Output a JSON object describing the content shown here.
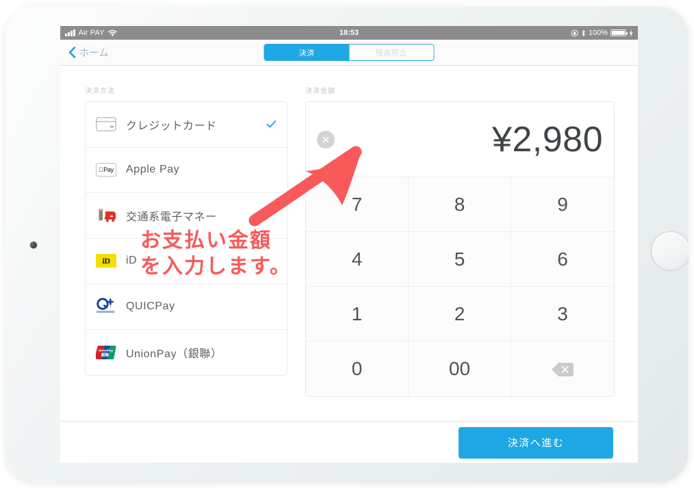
{
  "status_bar": {
    "signal_icon": "signal-bars-icon",
    "carrier": "Air PAY",
    "wifi_icon": "wifi-icon",
    "time": "18:53",
    "rotation_lock_icon": "rotation-lock-icon",
    "bluetooth_icon": "bluetooth-icon",
    "battery_percent": "100%",
    "battery_icon": "battery-icon",
    "charging_icon": "charging-bolt-icon"
  },
  "nav": {
    "back_icon": "chevron-left-icon",
    "back_label": "ホーム",
    "segments": [
      {
        "label": "決済",
        "active": true
      },
      {
        "label": "残高照会",
        "active": false
      }
    ]
  },
  "payment_methods": {
    "section_label": "決済方法",
    "items": [
      {
        "label": "クレジットカード",
        "icon": "credit-card-icon",
        "selected": true
      },
      {
        "label": "Apple Pay",
        "icon": "apple-pay-icon",
        "selected": false
      },
      {
        "label": "交通系電子マネー",
        "icon": "transit-ic-icon",
        "selected": false
      },
      {
        "label": "iD",
        "icon": "id-icon",
        "selected": false
      },
      {
        "label": "QUICPay",
        "icon": "quicpay-icon",
        "selected": false
      },
      {
        "label": "UnionPay（銀聯）",
        "icon": "unionpay-icon",
        "selected": false
      }
    ],
    "check_icon": "checkmark-icon"
  },
  "amount": {
    "section_label": "決済金額",
    "clear_icon": "clear-circle-icon",
    "value": "¥2,980",
    "currency": "¥",
    "number": "2,980"
  },
  "keypad": {
    "keys": [
      "7",
      "8",
      "9",
      "4",
      "5",
      "6",
      "1",
      "2",
      "3",
      "0",
      "00",
      ""
    ],
    "backspace_icon": "backspace-icon"
  },
  "footer": {
    "proceed_label": "決済へ進む"
  },
  "annotations": {
    "arrow_icon": "red-arrow-icon",
    "text": "お支払い金額\nを入力します。",
    "color": "#f85a5a"
  },
  "theme": {
    "accent": "#1fa7e5",
    "status_bar_bg": "#8c8c8c",
    "text_primary": "#4e5356",
    "label_gray": "#c2c8cb"
  }
}
